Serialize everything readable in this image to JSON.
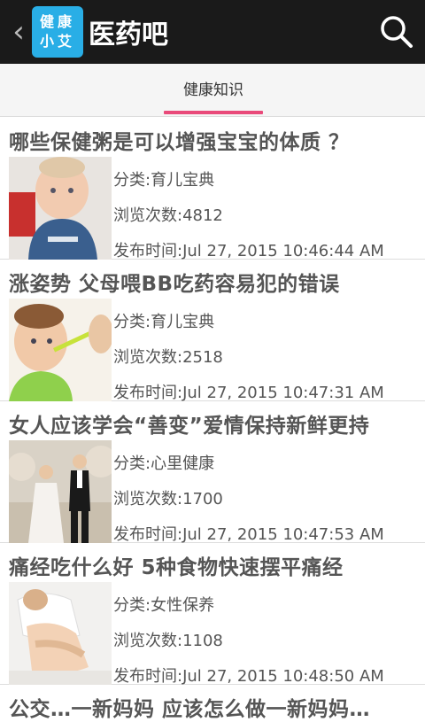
{
  "header": {
    "back_icon": "chevron-left-icon",
    "logo_line1": "健康",
    "logo_line2": "小艾",
    "title": "医药吧",
    "search_icon": "search-icon"
  },
  "tabs": [
    {
      "label": "健康知识",
      "selected": true
    }
  ],
  "colors": {
    "actionbar": "#1a1a1a",
    "logo": "#29aee6",
    "tab_indicator": "#e94a7a"
  },
  "articles": [
    {
      "title": "哪些保健粥是可以增强宝宝的体质 ？",
      "category": "分类:育儿宝典",
      "views": "浏览次数:4812",
      "published": "发布时间:Jul 27, 2015 10:46:44 AM",
      "thumb": "baby-photo"
    },
    {
      "title": "涨姿势 父母喂BB吃药容易犯的错误",
      "category": "分类:育儿宝典",
      "views": "浏览次数:2518",
      "published": "发布时间:Jul 27, 2015 10:47:31 AM",
      "thumb": "baby-feeding-photo"
    },
    {
      "title": "女人应该学会“善变”爱情保持新鲜更持",
      "category": "分类:心里健康",
      "views": "浏览次数:1700",
      "published": "发布时间:Jul 27, 2015 10:47:53 AM",
      "thumb": "wedding-couple-photo"
    },
    {
      "title": "痛经吃什么好 5种食物快速摆平痛经",
      "category": "分类:女性保养",
      "views": "浏览次数:1108",
      "published": "发布时间:Jul 27, 2015 10:48:50 AM",
      "thumb": "woman-cramps-photo"
    },
    {
      "title": "公交…一新妈妈 应该怎么做一新妈妈…",
      "partial": true
    }
  ]
}
